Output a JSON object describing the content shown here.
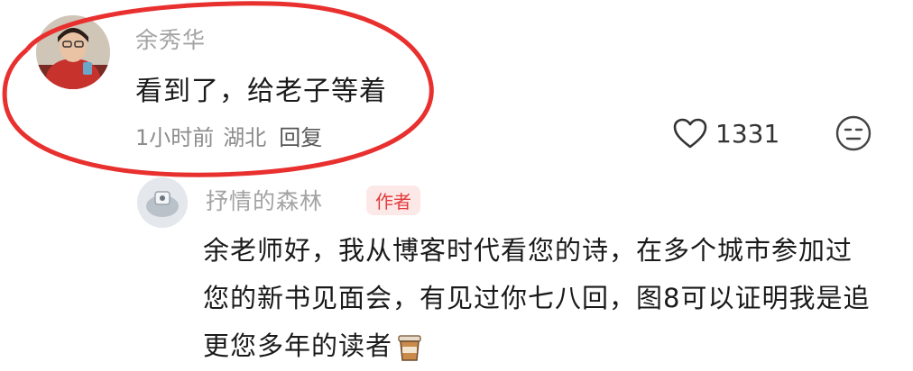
{
  "comment": {
    "username": "余秀华",
    "text": "看到了，给老子等着",
    "time": "1小时前",
    "location": "湖北",
    "reply_label": "回复",
    "like_count": "1331"
  },
  "reply": {
    "username": "抒情的森林",
    "badge": "作者",
    "text": "余老师好，我从博客时代看您的诗，在多个城市参加过您的新书见面会，有见过你七八回，图8可以证明我是追更您多年的读者"
  },
  "colors": {
    "highlight": "#e8302f",
    "badge_text": "#e23b3b",
    "badge_bg": "#fde8e8"
  },
  "icons": [
    "heart-outline-icon",
    "expressionless-face-icon",
    "coffee-cup-icon"
  ]
}
